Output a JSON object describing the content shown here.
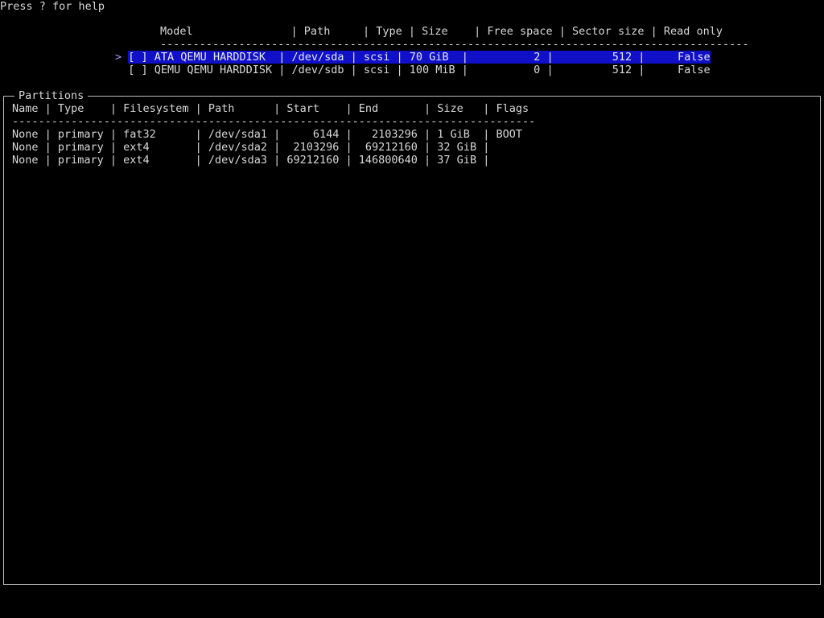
{
  "help_hint": "Press ? for help",
  "disks": {
    "header": "Model               | Path     | Type | Size    | Free space | Sector size | Read only",
    "rule": "------------------------------------------------------------------------------------------",
    "cursor": ">",
    "rows": [
      {
        "selected": true,
        "text": "[ ] ATA QEMU HARDDISK  | /dev/sda | scsi | 70 GiB  |          2 |         512 |     False"
      },
      {
        "selected": false,
        "text": "[ ] QEMU QEMU HARDDISK | /dev/sdb | scsi | 100 MiB |          0 |         512 |     False"
      }
    ]
  },
  "partitions": {
    "title": "Partitions",
    "header": "Name | Type    | Filesystem | Path      | Start    | End       | Size   | Flags",
    "rule": "--------------------------------------------------------------------------------",
    "rows": [
      "None | primary | fat32      | /dev/sda1 |     6144 |   2103296 | 1 GiB  | BOOT",
      "None | primary | ext4       | /dev/sda2 |  2103296 |  69212160 | 32 GiB |",
      "None | primary | ext4       | /dev/sda3 | 69212160 | 146800640 | 37 GiB |"
    ]
  },
  "colors": {
    "background": "#000000",
    "text": "#d8d8d8",
    "selection": "#1010c8",
    "frame": "#bdbdbd"
  }
}
